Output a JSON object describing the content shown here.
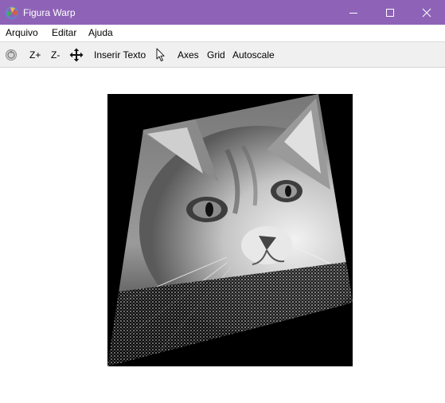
{
  "window": {
    "title": "Figura Warp",
    "icons": {
      "app": "matplotlib-app-icon",
      "minimize": "minimize-icon",
      "maximize": "maximize-icon",
      "close": "close-icon"
    }
  },
  "menu": {
    "file": "Arquivo",
    "edit": "Editar",
    "help": "Ajuda"
  },
  "toolbar": {
    "reset_icon": "home-reset-icon",
    "zoom_in": "Z+",
    "zoom_out": "Z-",
    "pan_icon": "move-arrows-icon",
    "insert_text": "Inserir Texto",
    "pointer_icon": "cursor-arrow-icon",
    "axes": "Axes",
    "grid": "Grid",
    "autoscale": "Autoscale"
  },
  "figure": {
    "description_icon": "warped-grayscale-cat-image",
    "background_color": "#000000",
    "accent_color": "#8e63b7"
  }
}
